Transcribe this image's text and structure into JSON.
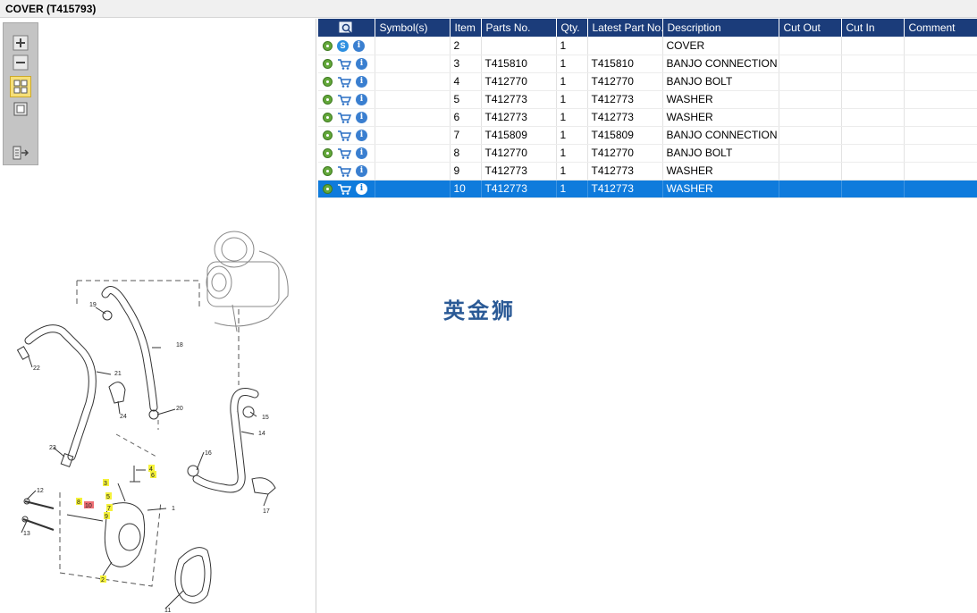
{
  "window": {
    "title": "COVER (T415793)"
  },
  "toolbox": {
    "buttons": [
      {
        "name": "zoom-in-icon"
      },
      {
        "name": "zoom-out-icon"
      },
      {
        "name": "fit-page-icon",
        "active": true
      },
      {
        "name": "actual-size-icon"
      },
      {
        "name": "export-icon"
      }
    ]
  },
  "table": {
    "headers": {
      "symbols": "Symbol(s)",
      "item": "Item",
      "parts_no": "Parts No.",
      "qty": "Qty.",
      "latest": "Latest Part No.",
      "description": "Description",
      "cut_out": "Cut Out",
      "cut_in": "Cut In",
      "comment": "Comment"
    },
    "rows": [
      {
        "item": "2",
        "parts_no": "",
        "qty": "1",
        "latest": "",
        "description": "COVER",
        "cut_out": "",
        "cut_in": "",
        "comment": "",
        "icon2": "s"
      },
      {
        "item": "3",
        "parts_no": "T415810",
        "qty": "1",
        "latest": "T415810",
        "description": "BANJO CONNECTION",
        "cut_out": "",
        "cut_in": "",
        "comment": "",
        "icon2": "cart"
      },
      {
        "item": "4",
        "parts_no": "T412770",
        "qty": "1",
        "latest": "T412770",
        "description": "BANJO BOLT",
        "cut_out": "",
        "cut_in": "",
        "comment": "",
        "icon2": "cart"
      },
      {
        "item": "5",
        "parts_no": "T412773",
        "qty": "1",
        "latest": "T412773",
        "description": "WASHER",
        "cut_out": "",
        "cut_in": "",
        "comment": "",
        "icon2": "cart"
      },
      {
        "item": "6",
        "parts_no": "T412773",
        "qty": "1",
        "latest": "T412773",
        "description": "WASHER",
        "cut_out": "",
        "cut_in": "",
        "comment": "",
        "icon2": "cart"
      },
      {
        "item": "7",
        "parts_no": "T415809",
        "qty": "1",
        "latest": "T415809",
        "description": "BANJO CONNECTION",
        "cut_out": "",
        "cut_in": "",
        "comment": "",
        "icon2": "cart"
      },
      {
        "item": "8",
        "parts_no": "T412770",
        "qty": "1",
        "latest": "T412770",
        "description": "BANJO BOLT",
        "cut_out": "",
        "cut_in": "",
        "comment": "",
        "icon2": "cart"
      },
      {
        "item": "9",
        "parts_no": "T412773",
        "qty": "1",
        "latest": "T412773",
        "description": "WASHER",
        "cut_out": "",
        "cut_in": "",
        "comment": "",
        "icon2": "cart"
      },
      {
        "item": "10",
        "parts_no": "T412773",
        "qty": "1",
        "latest": "T412773",
        "description": "WASHER",
        "cut_out": "",
        "cut_in": "",
        "comment": "",
        "icon2": "cart",
        "selected": true
      }
    ]
  },
  "watermark": "英金狮",
  "diagram": {
    "callouts": [
      {
        "label": "19"
      },
      {
        "label": "18"
      },
      {
        "label": "22"
      },
      {
        "label": "21"
      },
      {
        "label": "24"
      },
      {
        "label": "20"
      },
      {
        "label": "15"
      },
      {
        "label": "14"
      },
      {
        "label": "23"
      },
      {
        "label": "16"
      },
      {
        "label": "4",
        "highlight": "yellow"
      },
      {
        "label": "6",
        "highlight": "yellow"
      },
      {
        "label": "3",
        "highlight": "yellow"
      },
      {
        "label": "5",
        "highlight": "yellow"
      },
      {
        "label": "12"
      },
      {
        "label": "8",
        "highlight": "yellow"
      },
      {
        "label": "10",
        "highlight": "red"
      },
      {
        "label": "7",
        "highlight": "yellow"
      },
      {
        "label": "9",
        "highlight": "yellow"
      },
      {
        "label": "1"
      },
      {
        "label": "17"
      },
      {
        "label": "13"
      },
      {
        "label": "2",
        "highlight": "yellow"
      },
      {
        "label": "11"
      }
    ]
  },
  "colors": {
    "header_bg": "#1b3c7a",
    "selected_row": "#0f7bdc",
    "highlight_yellow": "#f5f23a",
    "highlight_red": "#ee6f74"
  }
}
